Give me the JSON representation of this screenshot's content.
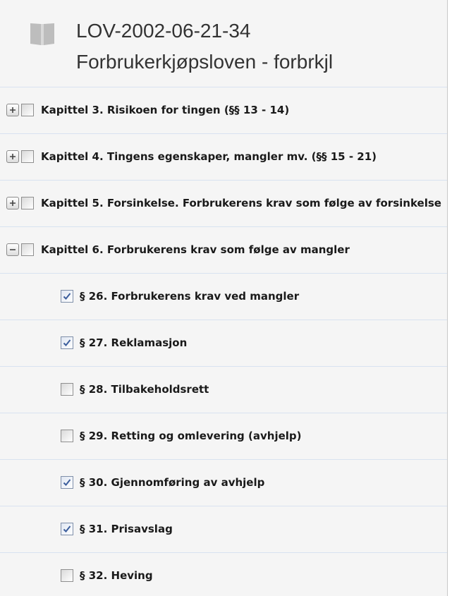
{
  "header": {
    "law_id": "LOV-2002-06-21-34",
    "law_title": "Forbrukerkjøpsloven - forbrkjl",
    "icon": "book-icon"
  },
  "colors": {
    "panel_background": "#f5f5f5",
    "divider": "#d8e2f0",
    "check_mark": "#3b5d9c",
    "text": "#1a1a1a",
    "title_text": "#333333"
  },
  "tree": {
    "chapters": [
      {
        "label": "Kapittel 3. Risikoen for tingen (§§ 13 - 14)",
        "expanded": false,
        "checked": false
      },
      {
        "label": "Kapittel 4. Tingens egenskaper, mangler mv. (§§ 15 - 21)",
        "expanded": false,
        "checked": false
      },
      {
        "label": "Kapittel 5. Forsinkelse. Forbrukerens krav som følge av forsinkelse",
        "expanded": false,
        "checked": false
      },
      {
        "label": "Kapittel 6. Forbrukerens krav som følge av mangler",
        "expanded": true,
        "checked": false
      }
    ],
    "sections": [
      {
        "label": "§ 26. Forbrukerens krav ved mangler",
        "checked": true
      },
      {
        "label": "§ 27. Reklamasjon",
        "checked": true
      },
      {
        "label": "§ 28. Tilbakeholdsrett",
        "checked": false
      },
      {
        "label": "§ 29. Retting og omlevering (avhjelp)",
        "checked": false
      },
      {
        "label": "§ 30. Gjennomføring av avhjelp",
        "checked": true
      },
      {
        "label": "§ 31. Prisavslag",
        "checked": true
      },
      {
        "label": "§ 32. Heving",
        "checked": false
      }
    ]
  }
}
